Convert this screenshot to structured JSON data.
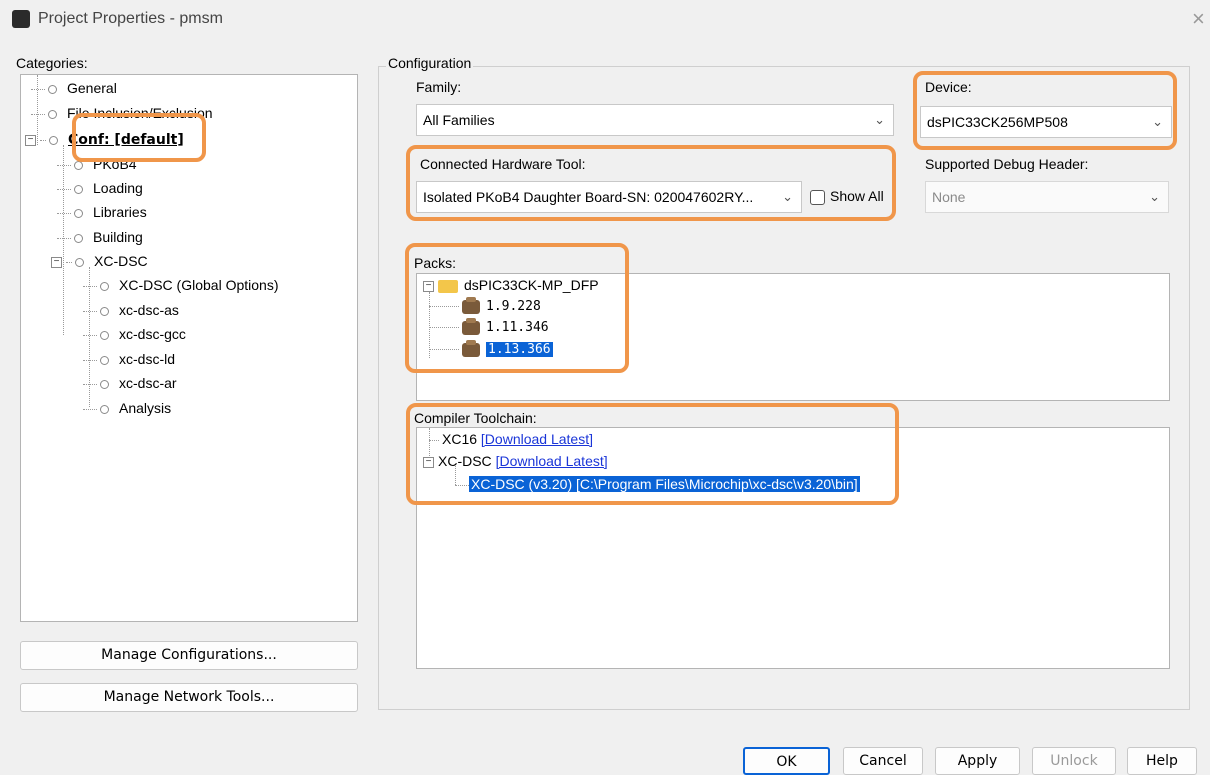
{
  "window": {
    "title": "Project Properties - pmsm",
    "close_glyph": "×"
  },
  "categories": {
    "label": "Categories:",
    "items": [
      {
        "label": "General"
      },
      {
        "label": "File Inclusion/Exclusion"
      },
      {
        "label": "Conf: [default]"
      },
      {
        "label": "PKoB4"
      },
      {
        "label": "Loading"
      },
      {
        "label": "Libraries"
      },
      {
        "label": "Building"
      },
      {
        "label": "XC-DSC"
      },
      {
        "label": "XC-DSC (Global Options)"
      },
      {
        "label": "xc-dsc-as"
      },
      {
        "label": "xc-dsc-gcc"
      },
      {
        "label": "xc-dsc-ld"
      },
      {
        "label": "xc-dsc-ar"
      },
      {
        "label": "Analysis"
      }
    ]
  },
  "buttons": {
    "manage_configurations": "Manage Configurations...",
    "manage_network_tools": "Manage Network Tools...",
    "ok": "OK",
    "cancel": "Cancel",
    "apply": "Apply",
    "unlock": "Unlock",
    "help": "Help"
  },
  "configuration": {
    "label": "Configuration",
    "family": {
      "label": "Family:",
      "value": "All Families"
    },
    "device": {
      "label": "Device:",
      "value": "dsPIC33CK256MP508"
    },
    "hardware_tool": {
      "label": "Connected Hardware Tool:",
      "value": "Isolated PKoB4 Daughter Board-SN: 020047602RY...",
      "show_all": "Show All"
    },
    "debug_header": {
      "label": "Supported Debug Header:",
      "value": "None"
    },
    "packs": {
      "label": "Packs:",
      "root": "dsPIC33CK-MP_DFP",
      "versions": [
        "1.9.228",
        "1.11.346",
        "1.13.366"
      ]
    },
    "toolchain": {
      "label": "Compiler Toolchain:",
      "xc16": "XC16",
      "xc16_link": "[Download Latest]",
      "xcdsc": "XC-DSC",
      "xcdsc_link": "[Download Latest]",
      "selected": "XC-DSC (v3.20) [C:\\Program Files\\Microchip\\xc-dsc\\v3.20\\bin]"
    }
  },
  "colors": {
    "highlight": "#f0964a",
    "selection": "#0a63d6",
    "link": "#1a35d8"
  }
}
